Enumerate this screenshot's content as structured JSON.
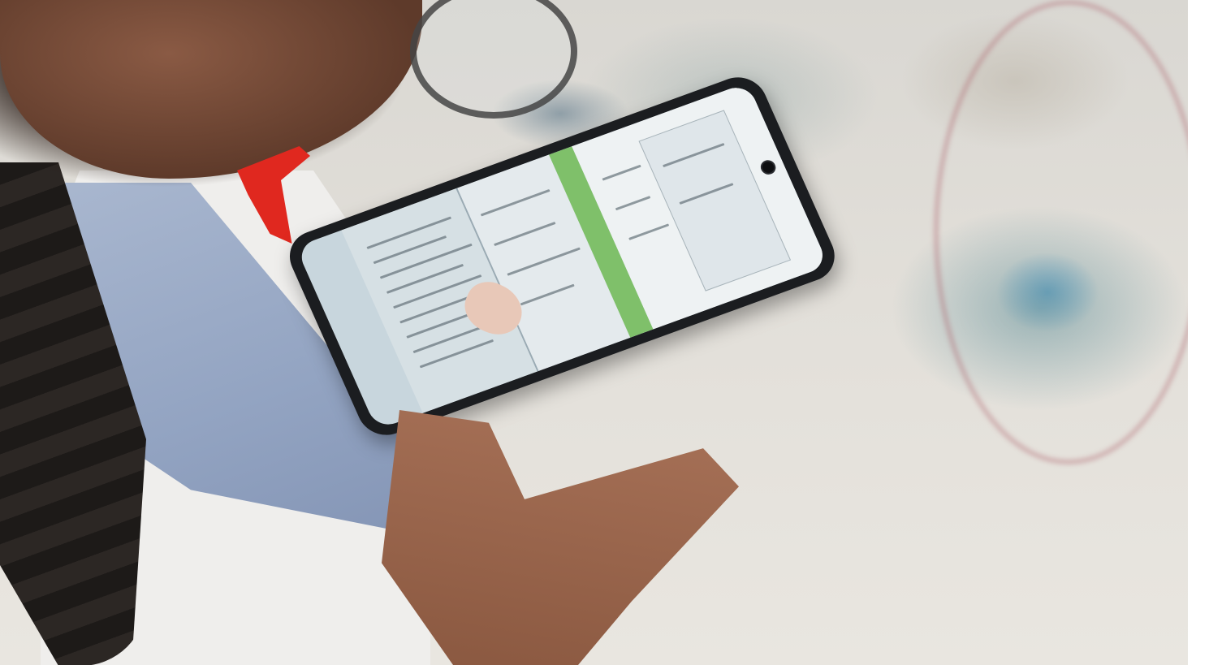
{
  "scene": {
    "description_type": "photo",
    "colors": {
      "floor": "#e2dfd9",
      "ribbon": "#e0281f",
      "shirt_blue": "#93a4c2",
      "phone_body": "#1b1d20",
      "screen_bg": "#c8d6dd",
      "screen_green_band": "#7fc06a"
    }
  }
}
